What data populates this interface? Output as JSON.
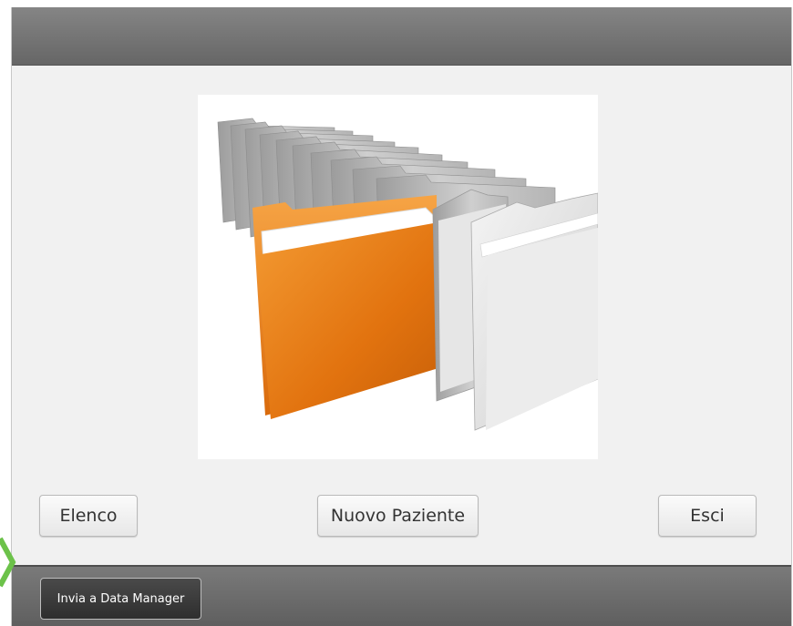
{
  "buttons": {
    "list_label": "Elenco",
    "new_patient_label": "Nuovo Paziente",
    "exit_label": "Esci"
  },
  "footer": {
    "send_label": "Invia a Data Manager"
  },
  "illustration": {
    "icon": "folders-illustration-icon",
    "highlight_color": "#f08a1c"
  },
  "overlay": {
    "icon": "green-pointer-arrow-icon",
    "color": "#6cc24a"
  }
}
